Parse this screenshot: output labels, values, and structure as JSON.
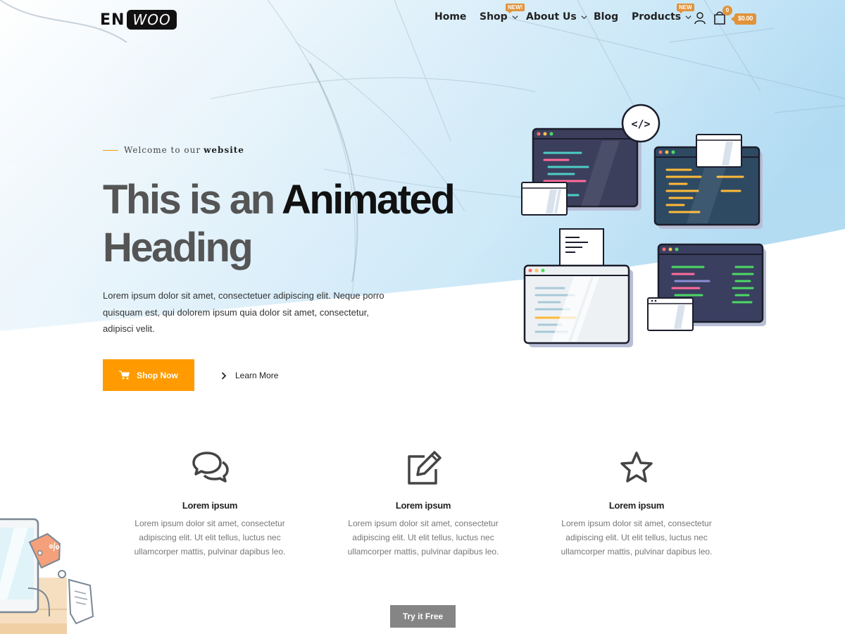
{
  "logo": {
    "part1": "EN",
    "part2": "WOO"
  },
  "nav": {
    "home": "Home",
    "shop": "Shop",
    "shop_badge": "NEW!",
    "about": "About Us",
    "blog": "Blog",
    "products": "Products",
    "products_badge": "NEW",
    "cart_count": "0",
    "cart_total": "$0.00"
  },
  "hero": {
    "welcome_prefix": "Welcome to our",
    "welcome_strong": "website",
    "title_light1": "This is an",
    "title_dark": "Animated",
    "title_light2": "Heading",
    "description": "Lorem ipsum dolor sit amet, consectetuer adipiscing elit. Neque porro quisquam est, qui dolorem ipsum quia dolor sit amet, consectetur, adipisci velit.",
    "shop_button": "Shop Now",
    "learn_button": "Learn More",
    "code_symbol": "</>"
  },
  "features": [
    {
      "icon": "comments-icon",
      "title": "Lorem ipsum",
      "desc": "Lorem ipsum dolor sit amet, consectetur adipiscing elit. Ut elit tellus, luctus nec ullamcorper mattis, pulvinar dapibus leo."
    },
    {
      "icon": "edit-icon",
      "title": "Lorem ipsum",
      "desc": "Lorem ipsum dolor sit amet, consectetur adipiscing elit. Ut elit tellus, luctus nec ullamcorper mattis, pulvinar dapibus leo."
    },
    {
      "icon": "star-icon",
      "title": "Lorem ipsum",
      "desc": "Lorem ipsum dolor sit amet, consectetur adipiscing elit. Ut elit tellus, luctus nec ullamcorper mattis, pulvinar dapibus leo."
    }
  ],
  "try_button": "Try it Free",
  "colors": {
    "accent": "#ff9b00",
    "badge": "#e0933a",
    "hero_sky": "#aad8f2",
    "button_grey": "#858585"
  }
}
